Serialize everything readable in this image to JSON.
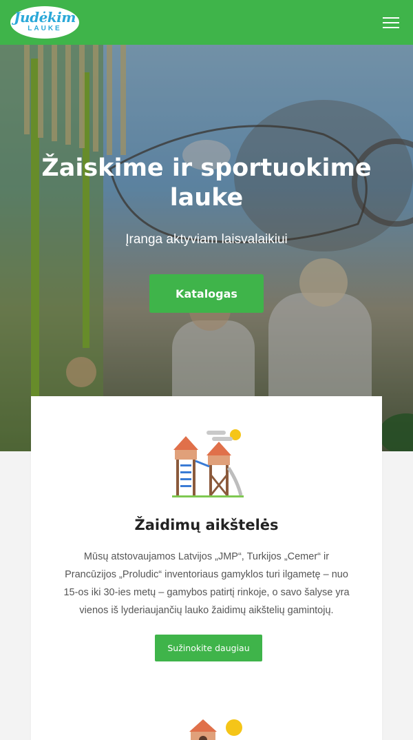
{
  "header": {
    "logo_line1": "Judėkim",
    "logo_line2": "LAUKE",
    "menu_icon": "hamburger-menu-icon",
    "background": "#3fb44a"
  },
  "hero": {
    "title": "Žaiskime ir sportuokime lauke",
    "subtitle": "Įranga aktyviam laisvalaikiui",
    "button_label": "Katalogas"
  },
  "card": {
    "icon": "playground-icon",
    "title": "Žaidimų aikštelės",
    "text": "Mūsų atstovaujamos Latvijos „JMP“, Turkijos „Cemer“ ir Prancūzijos „Proludic“ inventoriaus gamyklos turi ilgametę – nuo 15-os iki 30-ies metų – gamybos patirtį rinkoje, o savo šalyse yra vienos iš lyderiaujančių lauko žaidimų aikštelių gamintojų.",
    "button_label": "Sužinokite daugiau",
    "next_icon": "play-house-icon"
  },
  "colors": {
    "accent": "#3fb44a",
    "logo_text": "#2aa8d8"
  }
}
